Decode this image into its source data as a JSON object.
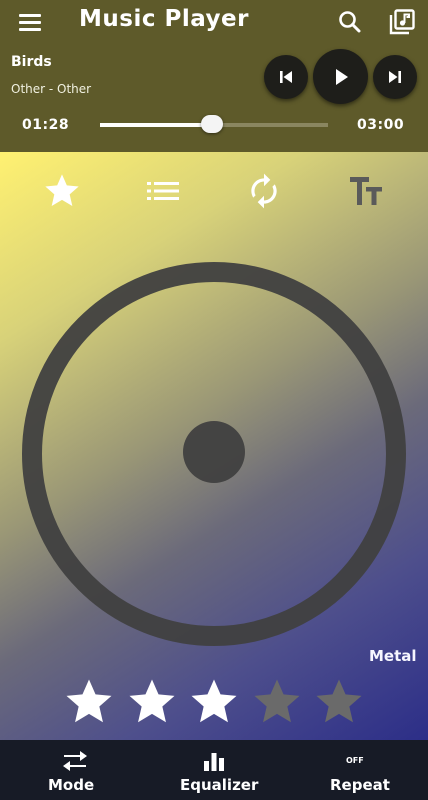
{
  "app_bar": {
    "title": "Music Player",
    "menu_icon": "menu-icon",
    "search_icon": "search-icon",
    "library_icon": "music-library-icon"
  },
  "now_playing": {
    "title": "Birds",
    "subtitle": "Other - Other",
    "current_time": "01:28",
    "total_time": "03:00",
    "progress": 0.49
  },
  "controls": {
    "prev_icon": "skip-previous-icon",
    "play_icon": "play-icon",
    "next_icon": "skip-next-icon"
  },
  "toolbar": {
    "favorite_icon": "star-icon",
    "list_icon": "list-icon",
    "repeat_icon": "repeat-icon",
    "text_size_icon": "text-size-icon"
  },
  "genre": "Metal",
  "rating": {
    "value": 3,
    "max": 5
  },
  "colors": {
    "top_bar": "#5e5a2a",
    "bottom_bar": "#171b26",
    "gradient_start": "#fff171",
    "gradient_end": "#2c2e88",
    "star_filled": "#ffffff",
    "star_empty": "#6a6a6a"
  },
  "bottom_nav": {
    "mode_label": "Mode",
    "equalizer_label": "Equalizer",
    "repeat_label": "Repeat",
    "repeat_state": "OFF"
  }
}
